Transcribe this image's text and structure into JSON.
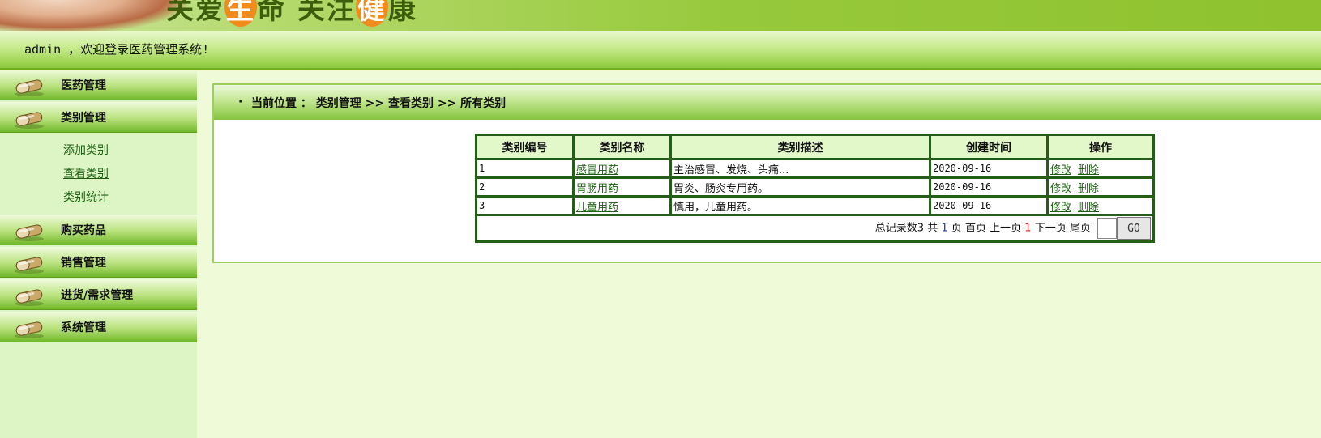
{
  "banner": {
    "slogan_pre": "关爱",
    "slogan_hl1": "生",
    "slogan_mid": "命  关注",
    "slogan_hl2": "健",
    "slogan_post": "康"
  },
  "welcome": "admin ，欢迎登录医药管理系统!",
  "sidebar": {
    "menus": [
      {
        "label": "医药管理"
      },
      {
        "label": "类别管理",
        "items": [
          "添加类别",
          "查看类别",
          "类别统计"
        ]
      },
      {
        "label": "购买药品"
      },
      {
        "label": "销售管理"
      },
      {
        "label": "进货/需求管理"
      },
      {
        "label": "系统管理"
      }
    ]
  },
  "panel": {
    "breadcrumb": "当前位置 ： 类别管理 >> 查看类别 >> 所有类别"
  },
  "table": {
    "headers": [
      "类别编号",
      "类别名称",
      "类别描述",
      "创建时间",
      "操作"
    ],
    "rows": [
      {
        "id": "1",
        "name": "感冒用药",
        "desc": "主治感冒、发烧、头痛...",
        "date": "2020-09-16"
      },
      {
        "id": "2",
        "name": "胃肠用药",
        "desc": "胃炎、肠炎专用药。",
        "date": "2020-09-16"
      },
      {
        "id": "3",
        "name": "儿童用药",
        "desc": "慎用，儿童用药。",
        "date": "2020-09-16"
      }
    ],
    "op_edit": "修改",
    "op_delete": "删除"
  },
  "pager": {
    "total_label": "总记录数3",
    "gong": "共",
    "pages": "1",
    "ye": "页",
    "first": "首页",
    "prev": "上一页",
    "current": "1",
    "next": "下一页",
    "last": "尾页",
    "go": "GO"
  },
  "colors": {
    "accent": "#8dca3b",
    "link": "#1c5e12",
    "table_border": "#245e18"
  }
}
